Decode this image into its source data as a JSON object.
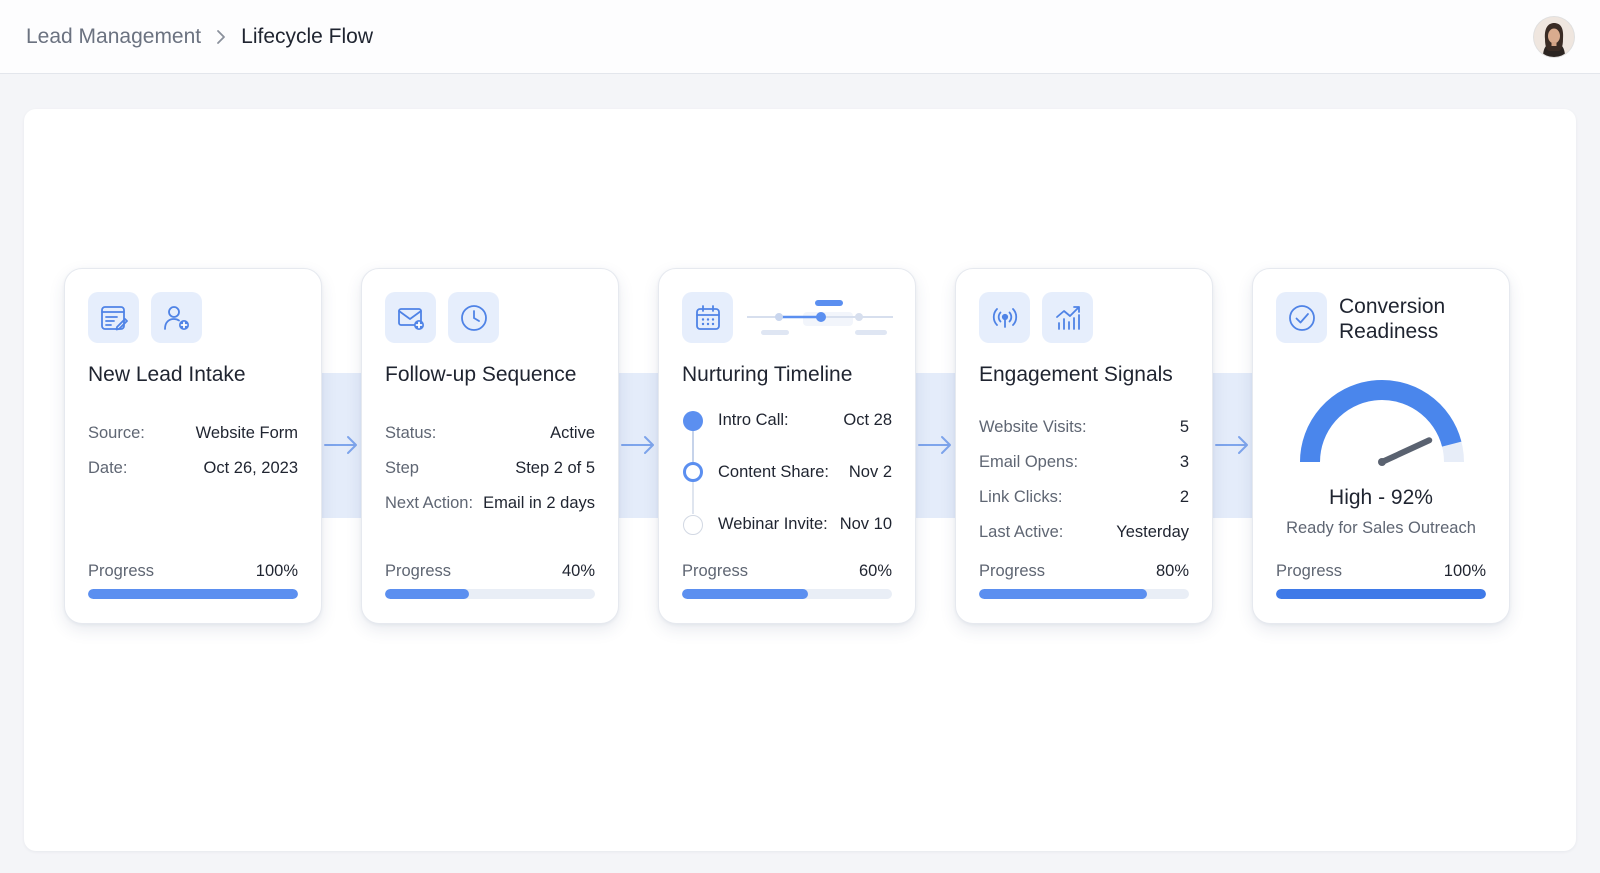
{
  "breadcrumb": {
    "parent": "Lead Management",
    "current": "Lifecycle Flow"
  },
  "colors": {
    "accent": "#5b8ff0",
    "accent_strong": "#3f7ae8",
    "icon_bg": "#e6eefc",
    "band": "#e4ecfa"
  },
  "stages": [
    {
      "title": "New Lead Intake",
      "icons": [
        "form-edit-icon",
        "add-user-icon"
      ],
      "fields": [
        {
          "label": "Source:",
          "value": "Website Form"
        },
        {
          "label": "Date:",
          "value": "Oct 26, 2023"
        }
      ],
      "progress_label": "Progress",
      "progress_text": "100%",
      "progress": 1.0
    },
    {
      "title": "Follow-up Sequence",
      "icons": [
        "mail-add-icon",
        "clock-icon"
      ],
      "fields": [
        {
          "label": "Status:",
          "value": "Active"
        },
        {
          "label": "Step",
          "value": "Step 2 of 5"
        },
        {
          "label": "Next Action:",
          "value": "Email in 2 days"
        }
      ],
      "progress_label": "Progress",
      "progress_text": "40%",
      "progress": 0.4
    },
    {
      "title": "Nurturing Timeline",
      "icons": [
        "calendar-icon",
        "timeline-icon"
      ],
      "events": [
        {
          "label": "Intro Call:",
          "date": "Oct 28",
          "state": "done"
        },
        {
          "label": "Content Share:",
          "date": "Nov 2",
          "state": "current"
        },
        {
          "label": "Webinar Invite:",
          "date": "Nov 10",
          "state": "upcoming"
        }
      ],
      "progress_label": "Progress",
      "progress_text": "60%",
      "progress": 0.6
    },
    {
      "title": "Engagement Signals",
      "icons": [
        "broadcast-icon",
        "trend-chart-icon"
      ],
      "fields": [
        {
          "label": "Website Visits:",
          "value": "5"
        },
        {
          "label": "Email Opens:",
          "value": "3"
        },
        {
          "label": "Link Clicks:",
          "value": "2"
        },
        {
          "label": "Last Active:",
          "value": "Yesterday"
        }
      ],
      "progress_label": "Progress",
      "progress_text": "80%",
      "progress": 0.8
    },
    {
      "title": "Conversion Readiness",
      "title_line1": "Conversion",
      "title_line2": "Readiness",
      "icons": [
        "check-circle-icon"
      ],
      "score_text": "High - 92%",
      "score": 0.92,
      "subtitle": "Ready for Sales Outreach",
      "progress_label": "Progress",
      "progress_text": "100%",
      "progress": 1.0
    }
  ]
}
